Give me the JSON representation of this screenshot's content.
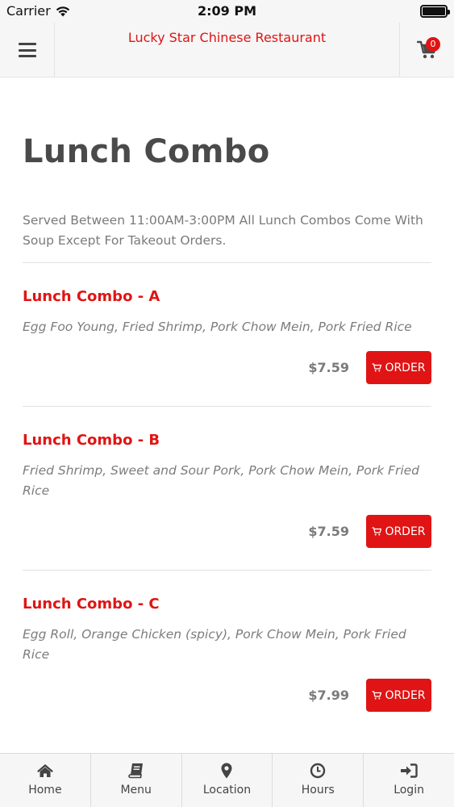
{
  "status_bar": {
    "carrier": "Carrier",
    "time": "2:09 PM",
    "battery_level": 1.0
  },
  "header": {
    "title": "Lucky Star Chinese Restaurant",
    "cart_count": "0",
    "menu_icon": "hamburger-icon",
    "cart_icon": "cart-icon"
  },
  "page": {
    "title": "Lunch Combo",
    "description": "Served Between 11:00AM-3:00PM All Lunch Combos Come With Soup Except For Takeout Orders."
  },
  "items": [
    {
      "name": "Lunch Combo - A",
      "description": "Egg Foo Young, Fried Shrimp, Pork Chow Mein, Pork Fried Rice",
      "price": "$7.59",
      "order_label": "ORDER"
    },
    {
      "name": "Lunch Combo - B",
      "description": "Fried Shrimp, Sweet and Sour Pork, Pork Chow Mein, Pork Fried Rice",
      "price": "$7.59",
      "order_label": "ORDER"
    },
    {
      "name": "Lunch Combo - C",
      "description": "Egg Roll, Orange Chicken (spicy), Pork Chow Mein, Pork Fried Rice",
      "price": "$7.99",
      "order_label": "ORDER"
    }
  ],
  "tabs": [
    {
      "label": "Home",
      "icon": "home-icon"
    },
    {
      "label": "Menu",
      "icon": "book-icon"
    },
    {
      "label": "Location",
      "icon": "map-pin-icon"
    },
    {
      "label": "Hours",
      "icon": "clock-icon"
    },
    {
      "label": "Login",
      "icon": "login-icon"
    }
  ],
  "colors": {
    "accent": "#e01414",
    "text": "#4a4a4a",
    "muted": "#7a7a7a",
    "bar_background": "#f6f6f6"
  }
}
